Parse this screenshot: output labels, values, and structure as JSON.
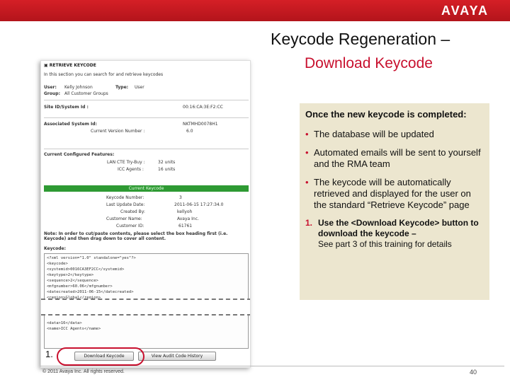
{
  "brand": {
    "logo": "AVAYA"
  },
  "slide": {
    "title_line1": "Keycode Regeneration –",
    "title_line2": "Download Keycode"
  },
  "screenshot": {
    "header": "RETRIEVE KEYCODE",
    "intro": "In this section you can search for and retrieve keycodes",
    "user_label": "User:",
    "user_value": "Kelly Johnson",
    "type_label": "Type:",
    "type_value": "User",
    "group_label": "Group:",
    "group_value": "All Customer Groups",
    "site_label": "Site ID/System Id :",
    "site_value": "00:16:CA:3E:F2:CC",
    "assoc_label": "Associated System Id:",
    "assoc_value": "NKTMHD0078H1",
    "version_label": "Current Version Number :",
    "version_value": "6.0",
    "features_label": "Current Configured Features:",
    "feature1_label": "LAN CTE Try-Buy :",
    "feature1_value": "32 units",
    "feature2_label": "ICC Agents :",
    "feature2_value": "16 units",
    "current_keycode": "Current Keycode",
    "kc_number_label": "Keycode Number:",
    "kc_number_value": "3",
    "update_label": "Last Update Date:",
    "update_value": "2011-06-15 17:27:34.0",
    "created_label": "Created By:",
    "created_value": "kellyoh",
    "customer_label": "Customer Name:",
    "customer_value": "Avaya Inc.",
    "custid_label": "Customer ID:",
    "custid_value": "61761",
    "note": "Note: In order to cut/paste contents, please select the box heading first (i.e. Keycode) and then drag down to cover all content.",
    "keycode_label": "Keycode:",
    "xml_lines": [
      "<?xml version=\"1.0\" standalone=\"yes\"?>",
      "<keycode>",
      "  <systemid>0016CA3EF2CC</systemid>",
      "  <keytype>2</keytype>",
      "  <sequence>2</sequence>",
      "  <mfgnumber>60.06</mfgnumber>",
      "  <datecreated>2011-06-15</datecreated>",
      "  <region>Global</region>"
    ],
    "xml_lines_after": [
      "    <data>16</data>",
      "    <name>ICC Agents</name>"
    ],
    "download_button": "Download Keycode",
    "history_button": "View Audit Code History"
  },
  "marker": "1.",
  "callout": {
    "intro": "Once the new keycode is completed:",
    "bullets": [
      "The database will be updated",
      "Automated emails will be sent to yourself and the RMA team",
      "The keycode will be automatically retrieved and displayed for the user on the standard “Retrieve Keycode” page"
    ],
    "bullet_symbol": "•",
    "step_number": "1.",
    "step_text": "Use the <Download Keycode> button to download the keycode –",
    "step_sub": "See part 3 of this training for  details"
  },
  "footer": {
    "copyright": "© 2011 Avaya Inc. All rights reserved.",
    "page_number": "40"
  },
  "colors": {
    "brand_red": "#c8102e",
    "callout_bg": "#ece6cf",
    "keycode_green": "#2e9a33"
  }
}
